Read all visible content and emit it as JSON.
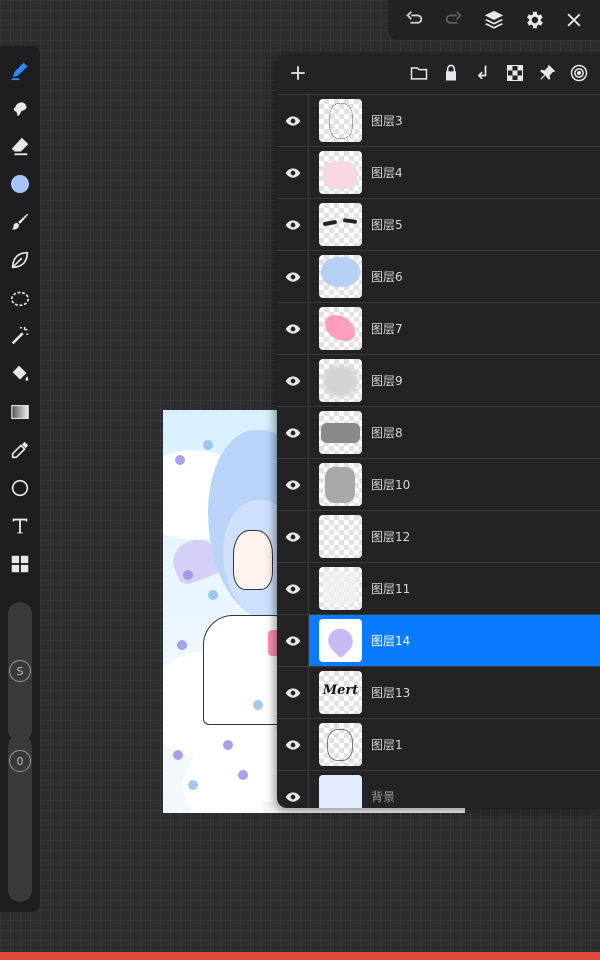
{
  "layers": {
    "items": [
      {
        "name": "图层3",
        "thumb": "sketch",
        "selected": false
      },
      {
        "name": "图层4",
        "thumb": "pink-soft",
        "selected": false
      },
      {
        "name": "图层5",
        "thumb": "eyelash",
        "selected": false
      },
      {
        "name": "图层6",
        "thumb": "blue-hair",
        "selected": false
      },
      {
        "name": "图层7",
        "thumb": "pink-bow",
        "selected": false
      },
      {
        "name": "图层9",
        "thumb": "gray-blur",
        "selected": false
      },
      {
        "name": "图层8",
        "thumb": "gray-top",
        "selected": false
      },
      {
        "name": "图层10",
        "thumb": "gray-fold",
        "selected": false
      },
      {
        "name": "图层12",
        "thumb": "empty",
        "selected": false
      },
      {
        "name": "图层11",
        "thumb": "light",
        "selected": false
      },
      {
        "name": "图层14",
        "thumb": "heart",
        "selected": true
      },
      {
        "name": "图层13",
        "thumb": "mert-text",
        "selected": false
      },
      {
        "name": "图层1",
        "thumb": "lineart",
        "selected": false
      },
      {
        "name": "背景",
        "thumb": "background",
        "selected": false
      }
    ]
  },
  "tools": {
    "brush_size_label": "S",
    "brush_opacity_label": "0",
    "current_color": "#a9c5ff"
  },
  "thumbnail_text": {
    "mert": "Mert"
  },
  "colors": {
    "selection": "#0a7aff",
    "background_layer": "#e3ecff",
    "bottom_stripe": "#e2483c"
  }
}
